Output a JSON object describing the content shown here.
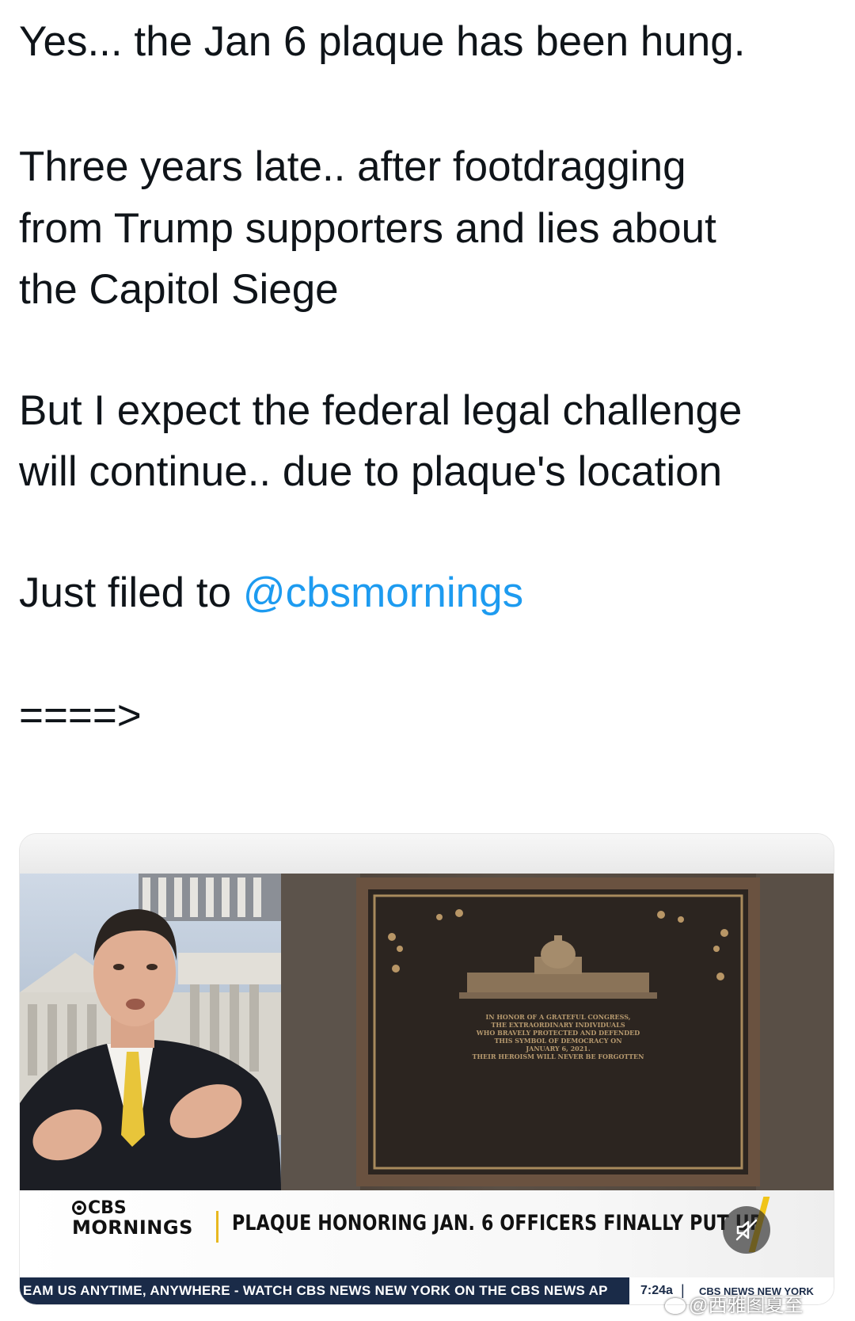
{
  "tweet": {
    "line_1": "Yes... the Jan 6 plaque has been hung.",
    "line_2": "Three years late.. after footdragging",
    "line_3": "from Trump supporters and lies about",
    "line_4": "the Capitol Siege",
    "line_5": "But I expect the federal legal challenge",
    "line_6": "will continue.. due to plaque's location",
    "line_7_prefix": "Just filed to ",
    "mention": "@cbsmornings",
    "arrow": "====>"
  },
  "media": {
    "logo_line1": "CBS",
    "logo_line2": "MORNINGS",
    "headline": "PLAQUE HONORING JAN. 6 OFFICERS FINALLY PUT UP",
    "ticker": "EAM US ANYTIME, ANYWHERE - WATCH CBS NEWS NEW YORK ON THE CBS NEWS AP",
    "ticker_time": "7:24a",
    "ticker_sep": "|",
    "ticker_network": "CBS NEWS NEW YORK",
    "plaque_text": [
      "IN HONOR OF A GRATEFUL CONGRESS,",
      "THE EXTRAORDINARY INDIVIDUALS",
      "WHO BRAVELY PROTECTED AND DEFENDED",
      "THIS SYMBOL OF DEMOCRACY ON",
      "JANUARY 6, 2021.",
      "THEIR HEROISM WILL NEVER BE FORGOTTEN"
    ]
  },
  "icons": {
    "mute": "speaker-muted-icon",
    "watermark": "weibo-icon"
  },
  "watermark": "@西雅图夏至",
  "colors": {
    "mention": "#1d9bf0",
    "ticker_bg": "#1a2b48",
    "accent_yellow": "#f0c419"
  }
}
